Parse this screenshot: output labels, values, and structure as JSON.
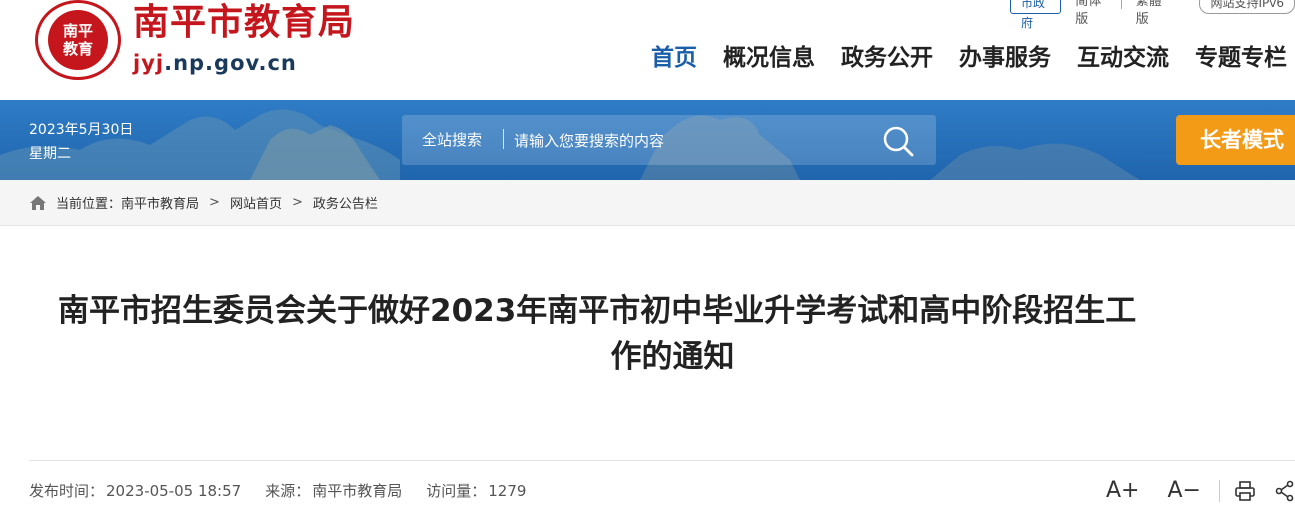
{
  "header": {
    "seal_text": "南平\n教育",
    "site_name": "南平市教育局",
    "domain_prefix": "jyj",
    "domain_rest": ".np.gov.cn",
    "topbar": {
      "city_gov": "市政府",
      "simplified": "简体版",
      "traditional": "繁體版",
      "accessibility": "网站支持IPv6"
    },
    "nav": [
      "首页",
      "概况信息",
      "政务公开",
      "办事服务",
      "互动交流",
      "专题专栏"
    ]
  },
  "banner": {
    "date": "2023年5月30日",
    "weekday": "星期二",
    "search_label": "全站搜索",
    "search_placeholder": "请输入您要搜索的内容",
    "elder_mode": "长者模式",
    "accent_color": "#f39a16",
    "banner_color": "#2672bd"
  },
  "breadcrumb": {
    "prefix": "当前位置：",
    "items": [
      "南平市教育局",
      "网站首页",
      "政务公告栏"
    ],
    "separator": ">"
  },
  "article": {
    "title_line1": "南平市招生委员会关于做好2023年南平市初中毕业升学考试和高中阶段招生工",
    "title_line2": "作的通知",
    "publish_label": "发布时间：",
    "publish_time": "2023-05-05 18:57",
    "source_label": "来源：",
    "source": "南平市教育局",
    "views_label": "访问量：",
    "views": "1279",
    "font_increase": "A+",
    "font_decrease": "A−"
  }
}
